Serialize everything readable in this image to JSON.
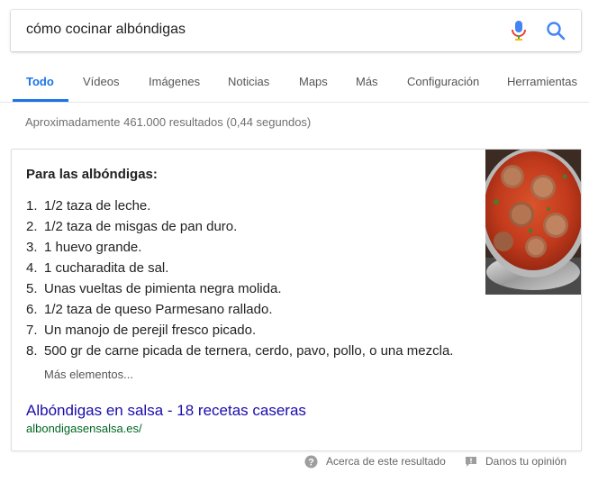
{
  "search": {
    "query": "cómo cocinar albóndigas"
  },
  "tabs": [
    {
      "label": "Todo"
    },
    {
      "label": "Vídeos"
    },
    {
      "label": "Imágenes"
    },
    {
      "label": "Noticias"
    },
    {
      "label": "Maps"
    },
    {
      "label": "Más"
    },
    {
      "label": "Configuración"
    },
    {
      "label": "Herramientas"
    }
  ],
  "result_stats": "Aproximadamente 461.000 resultados (0,44 segundos)",
  "snippet": {
    "heading": "Para las albóndigas:",
    "items": [
      {
        "num": "1.",
        "text": "1/2 taza de leche."
      },
      {
        "num": "2.",
        "text": "1/2 taza de misgas de pan duro."
      },
      {
        "num": "3.",
        "text": "1 huevo grande."
      },
      {
        "num": "4.",
        "text": "1 cucharadita de sal."
      },
      {
        "num": "5.",
        "text": "Unas vueltas de pimienta negra molida."
      },
      {
        "num": "6.",
        "text": "1/2 taza de queso Parmesano rallado."
      },
      {
        "num": "7.",
        "text": "Un manojo de perejil fresco picado."
      },
      {
        "num": "8.",
        "text": "500 gr de carne picada de ternera, cerdo, pavo, pollo, o una mezcla."
      }
    ],
    "more_label": "Más elementos...",
    "link_title": "Albóndigas en salsa - 18 recetas caseras",
    "link_url": "albondigasensalsa.es/",
    "image_icon": "meatballs-in-sauce-photo"
  },
  "footer": {
    "about_label": "Acerca de este resultado",
    "feedback_label": "Danos tu opinión"
  },
  "colors": {
    "accent": "#1a73e8",
    "link": "#1a0dab",
    "url": "#006621",
    "mic_red": "#ea4335"
  }
}
